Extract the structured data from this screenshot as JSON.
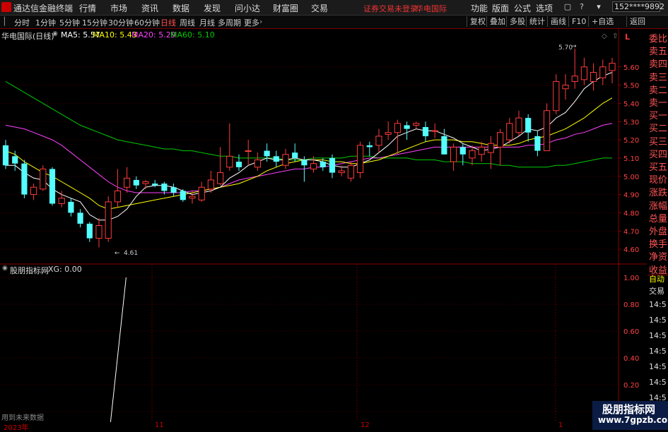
{
  "menubar": {
    "app_title": "通达信金融终端",
    "items": [
      "行情",
      "市场",
      "资讯",
      "数据",
      "发现",
      "问小达",
      "财富圈",
      "交易"
    ],
    "status_left": "证券交易未登录",
    "status_right": "华电国际",
    "right_items": [
      "功能",
      "版面",
      "公式",
      "选项"
    ],
    "account": "152****9892"
  },
  "toolbar": {
    "periods": [
      "分时",
      "1分钟",
      "5分钟",
      "15分钟",
      "30分钟",
      "60分钟",
      "日线",
      "周线",
      "月线",
      "多周期",
      "更多"
    ],
    "active_period": "日线",
    "right_buttons": [
      "复权",
      "叠加",
      "多股",
      "统计",
      "画线",
      "F10",
      "+自选",
      "返回"
    ]
  },
  "chart": {
    "stock_title": "华电国际(日线)",
    "legend": [
      {
        "label": "MA5: 5.57",
        "color": "#ffffff"
      },
      {
        "label": "MA10: 5.43",
        "color": "#ffff00"
      },
      {
        "label": "MA20: 5.29",
        "color": "#ff40ff"
      },
      {
        "label": "MA60: 5.10",
        "color": "#00cc00"
      }
    ],
    "high_label": "5.70",
    "low_label": "4.61",
    "y_ticks": [
      "5.60",
      "5.50",
      "5.40",
      "5.30",
      "5.20",
      "5.10",
      "5.00",
      "4.90",
      "4.80",
      "4.70",
      "4.60"
    ],
    "corner": "L"
  },
  "chart_data": {
    "type": "candlestick",
    "ylim": [
      4.55,
      5.75
    ],
    "open": [
      5.17,
      5.11,
      5.07,
      4.9,
      4.93,
      5.04,
      4.85,
      4.86,
      4.8,
      4.74,
      4.66,
      4.66,
      4.86,
      4.94,
      4.98,
      4.96,
      4.96,
      4.96,
      4.94,
      4.92,
      4.88,
      4.87,
      4.93,
      4.96,
      5.05,
      5.08,
      5.14,
      5.05,
      5.14,
      5.11,
      5.06,
      5.13,
      5.09,
      5.04,
      5.08,
      5.1,
      5.02,
      4.99,
      5.02,
      5.17,
      5.17,
      5.23,
      5.24,
      5.28,
      5.28,
      5.27,
      5.25,
      5.22,
      5.08,
      5.16,
      5.1,
      5.12,
      5.13,
      5.16,
      5.2,
      5.24,
      5.32,
      5.22,
      5.14,
      5.36,
      5.48,
      5.52,
      5.53,
      5.52,
      5.54,
      5.58
    ],
    "close": [
      5.06,
      5.07,
      4.9,
      4.94,
      5.04,
      4.85,
      4.88,
      4.8,
      4.74,
      4.66,
      4.73,
      4.86,
      4.92,
      4.99,
      4.95,
      4.97,
      4.95,
      4.92,
      4.91,
      4.87,
      4.89,
      4.94,
      4.98,
      5.02,
      5.11,
      5.05,
      5.14,
      5.09,
      5.11,
      5.08,
      5.12,
      5.1,
      5.06,
      5.07,
      5.05,
      5.02,
      5.03,
      5.06,
      5.17,
      5.16,
      5.22,
      5.24,
      5.29,
      5.26,
      5.29,
      5.22,
      5.25,
      5.12,
      5.16,
      5.12,
      5.14,
      5.16,
      5.18,
      5.24,
      5.29,
      5.32,
      5.24,
      5.14,
      5.36,
      5.52,
      5.5,
      5.55,
      5.6,
      5.57,
      5.6,
      5.62
    ],
    "high": [
      5.2,
      5.14,
      5.09,
      4.96,
      5.06,
      5.05,
      4.92,
      4.88,
      4.82,
      4.75,
      4.77,
      4.89,
      5.04,
      5.05,
      5.0,
      4.98,
      4.98,
      4.97,
      4.96,
      4.93,
      4.92,
      4.97,
      5.03,
      5.16,
      5.29,
      5.12,
      5.2,
      5.13,
      5.18,
      5.14,
      5.15,
      5.18,
      5.11,
      5.11,
      5.1,
      5.12,
      5.06,
      5.08,
      5.19,
      5.19,
      5.26,
      5.3,
      5.31,
      5.3,
      5.3,
      5.3,
      5.29,
      5.26,
      5.18,
      5.18,
      5.17,
      5.19,
      5.22,
      5.26,
      5.32,
      5.36,
      5.34,
      5.25,
      5.4,
      5.56,
      5.56,
      5.7,
      5.65,
      5.62,
      5.64,
      5.65
    ],
    "low": [
      5.04,
      5.03,
      4.88,
      4.87,
      4.92,
      4.84,
      4.83,
      4.78,
      4.72,
      4.64,
      4.61,
      4.64,
      4.83,
      4.91,
      4.93,
      4.93,
      4.94,
      4.9,
      4.89,
      4.86,
      4.85,
      4.86,
      4.91,
      4.95,
      5.03,
      5.03,
      5.06,
      5.03,
      5.08,
      5.05,
      5.04,
      5.08,
      4.97,
      5.02,
      5.03,
      4.99,
      5.0,
      4.97,
      4.99,
      5.11,
      5.13,
      5.2,
      5.12,
      5.2,
      5.26,
      5.19,
      5.21,
      5.12,
      5.03,
      5.06,
      5.06,
      5.08,
      5.04,
      5.06,
      5.18,
      5.22,
      5.19,
      5.11,
      5.14,
      5.34,
      5.42,
      5.48,
      5.5,
      5.47,
      5.5,
      5.51
    ],
    "ma5": [
      5.06,
      5.06,
      5.02,
      4.99,
      4.98,
      4.93,
      4.9,
      4.88,
      4.86,
      4.79,
      4.76,
      4.76,
      4.78,
      4.82,
      4.89,
      4.94,
      4.95,
      4.95,
      4.94,
      4.92,
      4.9,
      4.91,
      4.92,
      4.94,
      4.99,
      5.02,
      5.06,
      5.08,
      5.1,
      5.09,
      5.09,
      5.1,
      5.09,
      5.09,
      5.08,
      5.06,
      5.05,
      5.05,
      5.07,
      5.09,
      5.13,
      5.17,
      5.22,
      5.24,
      5.26,
      5.25,
      5.25,
      5.23,
      5.21,
      5.18,
      5.16,
      5.14,
      5.15,
      5.16,
      5.19,
      5.22,
      5.26,
      5.25,
      5.27,
      5.32,
      5.35,
      5.41,
      5.48,
      5.52,
      5.55,
      5.57
    ],
    "ma10": [
      5.14,
      5.12,
      5.08,
      5.05,
      5.02,
      5.0,
      4.97,
      4.94,
      4.91,
      4.88,
      4.84,
      4.82,
      4.83,
      4.84,
      4.85,
      4.86,
      4.87,
      4.88,
      4.89,
      4.9,
      4.91,
      4.92,
      4.93,
      4.94,
      4.95,
      4.96,
      4.98,
      5.0,
      5.03,
      5.05,
      5.07,
      5.08,
      5.09,
      5.09,
      5.09,
      5.08,
      5.08,
      5.07,
      5.07,
      5.08,
      5.09,
      5.11,
      5.13,
      5.15,
      5.17,
      5.19,
      5.2,
      5.2,
      5.2,
      5.19,
      5.19,
      5.18,
      5.17,
      5.17,
      5.17,
      5.18,
      5.2,
      5.21,
      5.22,
      5.24,
      5.26,
      5.29,
      5.32,
      5.36,
      5.4,
      5.43
    ],
    "ma20": [
      5.28,
      5.27,
      5.26,
      5.24,
      5.22,
      5.2,
      5.17,
      5.13,
      5.09,
      5.05,
      5.01,
      4.97,
      4.94,
      4.92,
      4.91,
      4.91,
      4.91,
      4.91,
      4.91,
      4.91,
      4.92,
      4.92,
      4.93,
      4.94,
      4.96,
      4.98,
      4.99,
      5.0,
      5.01,
      5.02,
      5.03,
      5.04,
      5.04,
      5.05,
      5.05,
      5.06,
      5.07,
      5.08,
      5.09,
      5.1,
      5.1,
      5.11,
      5.12,
      5.13,
      5.14,
      5.15,
      5.16,
      5.16,
      5.16,
      5.16,
      5.16,
      5.16,
      5.16,
      5.16,
      5.16,
      5.16,
      5.17,
      5.17,
      5.18,
      5.2,
      5.21,
      5.23,
      5.24,
      5.26,
      5.28,
      5.29
    ],
    "ma60": [
      5.52,
      5.49,
      5.46,
      5.43,
      5.4,
      5.37,
      5.34,
      5.31,
      5.28,
      5.26,
      5.24,
      5.22,
      5.2,
      5.19,
      5.18,
      5.17,
      5.16,
      5.15,
      5.15,
      5.14,
      5.14,
      5.13,
      5.12,
      5.11,
      5.11,
      5.1,
      5.1,
      5.1,
      5.1,
      5.1,
      5.09,
      5.09,
      5.09,
      5.1,
      5.1,
      5.1,
      5.1,
      5.11,
      5.11,
      5.11,
      5.1,
      5.1,
      5.1,
      5.1,
      5.09,
      5.09,
      5.09,
      5.08,
      5.08,
      5.08,
      5.07,
      5.07,
      5.07,
      5.06,
      5.06,
      5.05,
      5.05,
      5.05,
      5.05,
      5.06,
      5.06,
      5.07,
      5.08,
      5.09,
      5.1,
      5.1
    ],
    "xg": [
      0,
      0,
      0,
      0,
      0,
      0,
      0,
      0,
      0,
      0,
      0,
      0,
      1,
      0,
      0,
      0,
      0,
      0,
      0,
      0,
      0,
      0,
      0,
      0,
      0,
      0,
      0,
      0,
      0,
      0,
      0,
      0,
      0,
      0,
      0,
      0,
      0,
      0,
      0,
      0,
      0,
      0,
      0,
      0,
      0,
      0,
      0,
      0,
      0,
      0,
      0,
      0,
      0,
      0,
      0,
      0,
      0,
      0,
      0,
      0,
      0,
      0,
      0,
      0,
      0,
      0
    ]
  },
  "indicator": {
    "title": "股朋指标网",
    "value": "XG: 0.00",
    "y_ticks": [
      "1.00",
      "0.80",
      "0.60",
      "0.40",
      "0.20",
      "0"
    ],
    "footnote": "用到未来数据",
    "x_labels": [
      "2023年",
      "11",
      "12",
      "1"
    ]
  },
  "right_panel": {
    "labels": [
      "委比",
      "卖五",
      "卖四",
      "卖三",
      "卖二",
      "卖一",
      "买一",
      "买二",
      "买三",
      "买四",
      "买五",
      "现价",
      "涨跌",
      "涨幅",
      "总量",
      "外盘",
      "换手",
      "净资",
      "收益"
    ],
    "tabs": [
      "自动",
      "交易"
    ],
    "times": [
      "14:5",
      "14:5",
      "14:5",
      "14:5",
      "14:5",
      "14:5",
      "14:5",
      "14:5"
    ]
  },
  "watermark": {
    "line1": "股朋指标网",
    "line2": "www.7gpzb.com"
  }
}
